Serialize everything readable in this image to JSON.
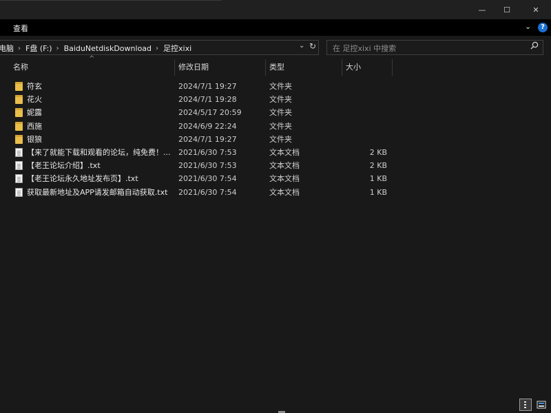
{
  "window": {
    "minimize_glyph": "—",
    "maximize_glyph": "☐",
    "close_glyph": "✕"
  },
  "ribbon": {
    "view_tab": "查看",
    "collapse_glyph": "⌄",
    "help_glyph": "?"
  },
  "breadcrumb": [
    {
      "label": "此电脑"
    },
    {
      "label": "F盘 (F:)"
    },
    {
      "label": "BaiduNetdiskDownload"
    },
    {
      "label": "足控xixi"
    }
  ],
  "breadcrumb_sep": "›",
  "address": {
    "dropdown_glyph": "⌄",
    "refresh_glyph": "↻"
  },
  "search": {
    "placeholder": "在 足控xixi 中搜索",
    "icon": "search-icon"
  },
  "columns": {
    "name": "名称",
    "date": "修改日期",
    "type": "类型",
    "size": "大小",
    "sort_glyph": "^"
  },
  "files": [
    {
      "name": "符玄",
      "date": "2024/7/1 19:27",
      "type": "文件夹",
      "size": "",
      "icon": "folder-icon"
    },
    {
      "name": "花火",
      "date": "2024/7/1 19:28",
      "type": "文件夹",
      "size": "",
      "icon": "folder-icon"
    },
    {
      "name": "妮露",
      "date": "2024/5/17 20:59",
      "type": "文件夹",
      "size": "",
      "icon": "folder-icon"
    },
    {
      "name": "西施",
      "date": "2024/6/9 22:24",
      "type": "文件夹",
      "size": "",
      "icon": "folder-icon"
    },
    {
      "name": "银狼",
      "date": "2024/7/1 19:27",
      "type": "文件夹",
      "size": "",
      "icon": "folder-icon"
    },
    {
      "name": "【来了就能下载和观看的论坛，纯免费！...",
      "date": "2021/6/30 7:53",
      "type": "文本文档",
      "size": "2 KB",
      "icon": "text-file-icon"
    },
    {
      "name": "【老王论坛介绍】.txt",
      "date": "2021/6/30 7:53",
      "type": "文本文档",
      "size": "2 KB",
      "icon": "text-file-icon"
    },
    {
      "name": "【老王论坛永久地址发布页】.txt",
      "date": "2021/6/30 7:54",
      "type": "文本文档",
      "size": "1 KB",
      "icon": "text-file-icon"
    },
    {
      "name": "获取最新地址及APP请发邮箱自动获取.txt",
      "date": "2021/6/30 7:54",
      "type": "文本文档",
      "size": "1 KB",
      "icon": "text-file-icon"
    }
  ],
  "statusbar": {
    "details_view_icon": "details-view-icon",
    "large_icons_view_icon": "large-icons-view-icon"
  },
  "colors": {
    "folder": "#e9be4b",
    "help": "#1c6fd0",
    "background": "#191919"
  }
}
